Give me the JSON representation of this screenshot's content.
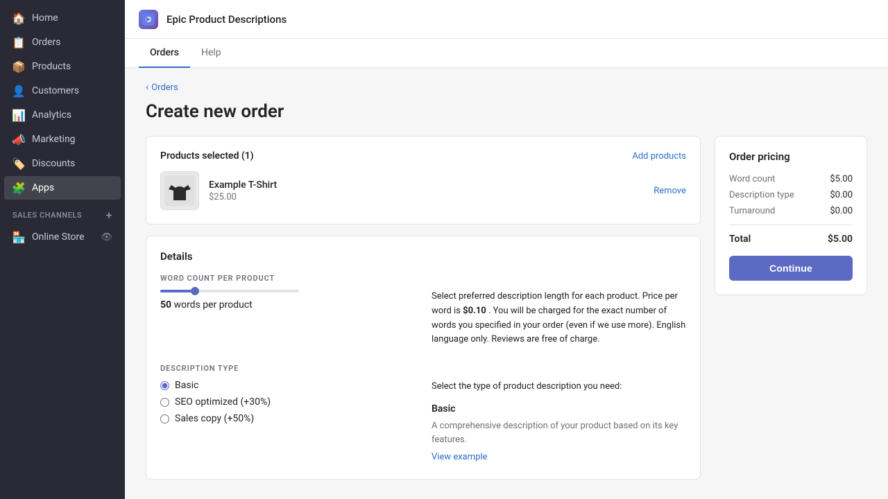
{
  "sidebar": {
    "items": [
      {
        "id": "home",
        "label": "Home",
        "icon": "🏠",
        "active": false
      },
      {
        "id": "orders",
        "label": "Orders",
        "icon": "📋",
        "active": false
      },
      {
        "id": "products",
        "label": "Products",
        "icon": "📦",
        "active": false
      },
      {
        "id": "customers",
        "label": "Customers",
        "icon": "👤",
        "active": false
      },
      {
        "id": "analytics",
        "label": "Analytics",
        "icon": "📊",
        "active": false
      },
      {
        "id": "marketing",
        "label": "Marketing",
        "icon": "📣",
        "active": false
      },
      {
        "id": "discounts",
        "label": "Discounts",
        "icon": "🏷️",
        "active": false
      },
      {
        "id": "apps",
        "label": "Apps",
        "icon": "🧩",
        "active": true
      }
    ],
    "sales_channels_label": "SALES CHANNELS",
    "online_store_label": "Online Store"
  },
  "header": {
    "app_title": "Epic Product Descriptions",
    "app_icon": "🌟"
  },
  "tabs": [
    {
      "id": "orders",
      "label": "Orders",
      "active": true
    },
    {
      "id": "help",
      "label": "Help",
      "active": false
    }
  ],
  "breadcrumb": {
    "text": "Orders"
  },
  "page": {
    "title": "Create new order"
  },
  "products_card": {
    "title": "Products selected (1)",
    "add_products_label": "Add products",
    "product": {
      "name": "Example T-Shirt",
      "price": "$25.00",
      "remove_label": "Remove"
    }
  },
  "details_card": {
    "word_count_section": {
      "label": "WORD COUNT PER PRODUCT",
      "value": 50,
      "unit": "words per product",
      "description": "Select preferred description length for each product. Price per word is",
      "price_per_word": "$0.10",
      "description2": ". You will be charged for the exact number of words you specified in your order (even if we use more). English language only. Reviews are free of charge."
    },
    "description_type_section": {
      "label": "DESCRIPTION TYPE",
      "options": [
        {
          "id": "basic",
          "label": "Basic",
          "checked": true
        },
        {
          "id": "seo",
          "label": "SEO optimized (+30%)",
          "checked": false
        },
        {
          "id": "sales",
          "label": "Sales copy (+50%)",
          "checked": false
        }
      ],
      "right_title": "Select the type of product description you need:",
      "selected_type_title": "Basic",
      "selected_type_desc": "A comprehensive description of your product based on its key features.",
      "view_example_label": "View example"
    }
  },
  "order_pricing": {
    "title": "Order pricing",
    "rows": [
      {
        "label": "Word count",
        "amount": "$5.00"
      },
      {
        "label": "Description type",
        "amount": "$0.00"
      },
      {
        "label": "Turnaround",
        "amount": "$0.00"
      }
    ],
    "total_label": "Total",
    "total_amount": "$5.00",
    "continue_label": "Continue"
  }
}
